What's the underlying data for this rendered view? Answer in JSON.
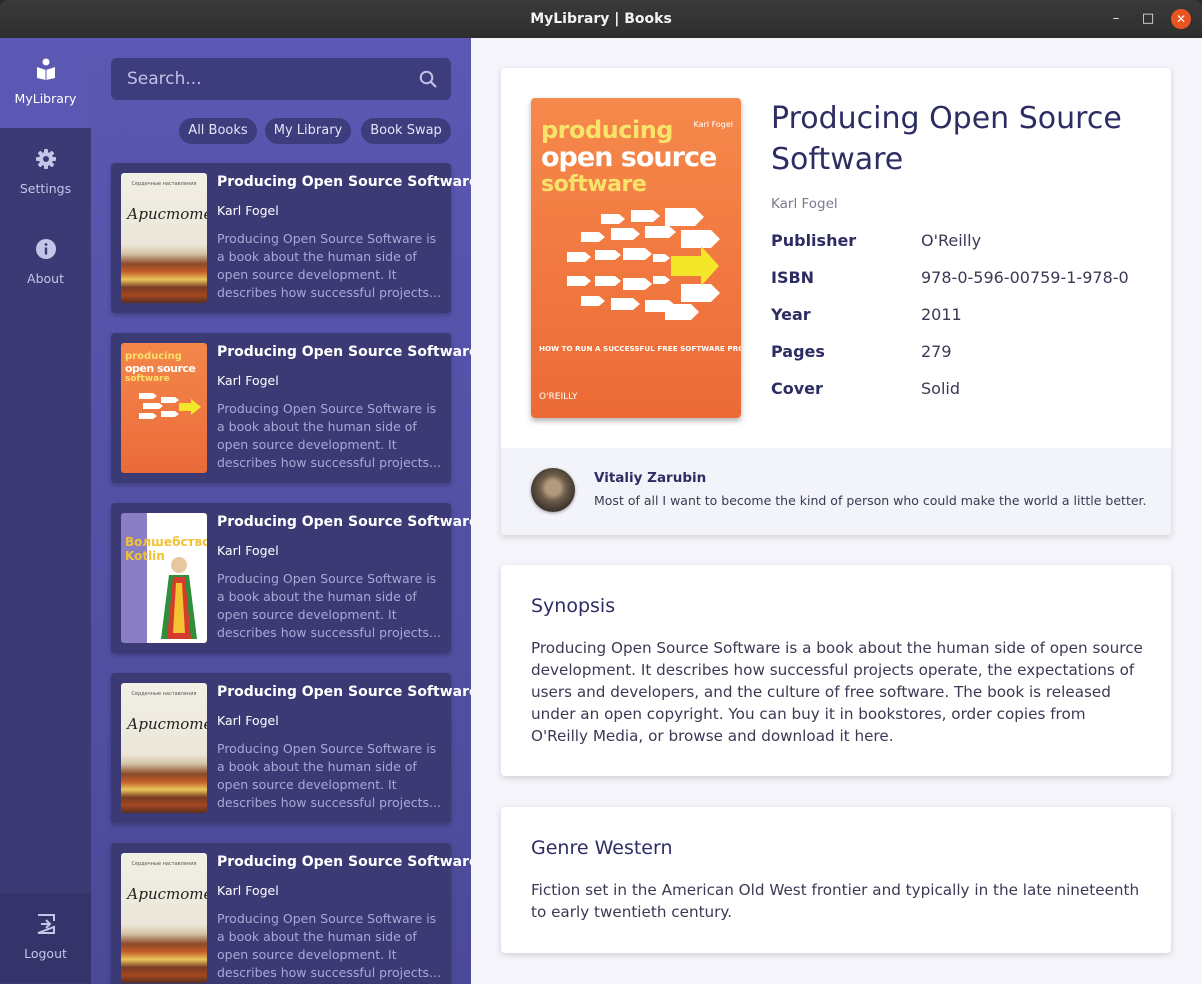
{
  "window": {
    "title": "MyLibrary | Books",
    "minimize_glyph": "–",
    "maximize_glyph": "□",
    "close_glyph": "✕"
  },
  "nav": {
    "items": [
      {
        "label": "MyLibrary",
        "icon": "book-reader-icon"
      },
      {
        "label": "Settings",
        "icon": "gear-icon"
      },
      {
        "label": "About",
        "icon": "info-icon"
      }
    ],
    "logout": {
      "label": "Logout",
      "icon": "logout-icon"
    }
  },
  "search": {
    "placeholder": "Search...",
    "value": ""
  },
  "filters": [
    "All Books",
    "My Library",
    "Book Swap"
  ],
  "books": [
    {
      "title": "Producing Open Source Software",
      "author": "Karl Fogel",
      "description": "Producing Open Source Software is a book about the human side of open source development. It describes how successful projects...",
      "cover_title": "Аристотель",
      "cover_subtitle": "Сердечные наставления"
    },
    {
      "title": "Producing Open Source Software",
      "author": "Karl Fogel",
      "description": "Producing Open Source Software is a book about the human side of open source development. It describes how successful projects...",
      "cover_line1": "producing",
      "cover_line2": "open source",
      "cover_line3": "software"
    },
    {
      "title": "Producing Open Source Software",
      "author": "Karl Fogel",
      "description": "Producing Open Source Software is a book about the human side of open source development. It describes how successful projects...",
      "cover_title": "Волшебство Kotlin"
    },
    {
      "title": "Producing Open Source Software",
      "author": "Karl Fogel",
      "description": "Producing Open Source Software is a book about the human side of open source development. It describes how successful projects...",
      "cover_title": "Аристотель",
      "cover_subtitle": "Сердечные наставления"
    },
    {
      "title": "Producing Open Source Software",
      "author": "Karl Fogel",
      "description": "Producing Open Source Software is a book about the human side of open source development. It describes how successful projects...",
      "cover_title": "Аристотель",
      "cover_subtitle": "Сердечные наставления"
    }
  ],
  "detail": {
    "title": "Producing Open Source Software",
    "author": "Karl Fogel",
    "cover": {
      "line1": "producing",
      "line2": "open source",
      "line3": "software",
      "author": "Karl Fogel",
      "subtitle": "HOW TO RUN A SUCCESSFUL FREE SOFTWARE PROJECT",
      "publisher": "O'REILLY"
    },
    "meta": [
      {
        "label": "Publisher",
        "value": "O'Reilly"
      },
      {
        "label": "ISBN",
        "value": "978-0-596-00759-1-978-0"
      },
      {
        "label": "Year",
        "value": "2011"
      },
      {
        "label": "Pages",
        "value": "279"
      },
      {
        "label": "Cover",
        "value": "Solid"
      }
    ],
    "review": {
      "name": "Vitaliy Zarubin",
      "text": "Most of all I want to become the kind of person who could make the world a little better."
    }
  },
  "synopsis": {
    "heading": "Synopsis",
    "text": "Producing Open Source Software is a book about the human side of open source development. It describes how successful projects operate, the expectations of users and developers, and the culture of free software. The book is released under an open copyright. You can buy it in bookstores, order copies from O'Reilly Media, or browse and download it here."
  },
  "genre": {
    "heading": "Genre Western",
    "text": "Fiction set in the American Old West frontier and typically in the late nineteenth to early twentieth century."
  },
  "colors": {
    "nav_bg": "#3b3a75",
    "nav_active": "#5a58b2",
    "list_bg": "#5a58b2",
    "card_bg": "#3b3a75",
    "heading": "#2e2d63",
    "close_button": "#e95420"
  }
}
